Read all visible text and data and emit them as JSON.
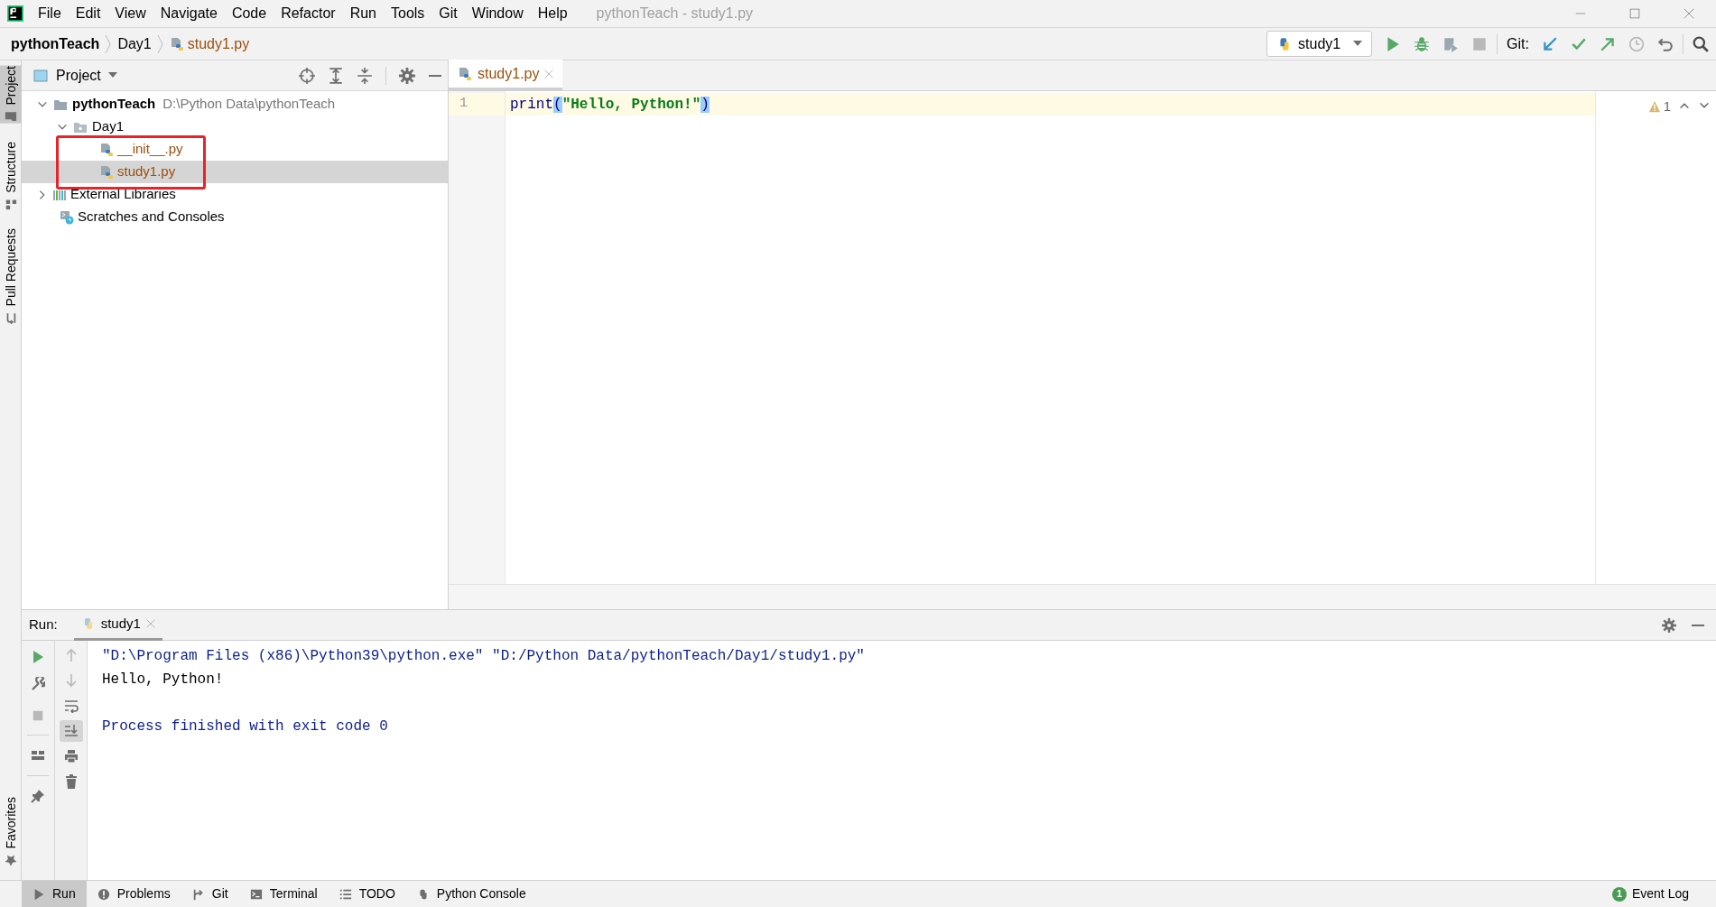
{
  "window": {
    "title": "pythonTeach - study1.py"
  },
  "menu": [
    "File",
    "Edit",
    "View",
    "Navigate",
    "Code",
    "Refactor",
    "Run",
    "Tools",
    "Git",
    "Window",
    "Help"
  ],
  "breadcrumb": [
    {
      "label": "pythonTeach",
      "kind": "project"
    },
    {
      "label": "Day1",
      "kind": "folder"
    },
    {
      "label": "study1.py",
      "kind": "py-file"
    }
  ],
  "toolbar": {
    "run_config": "study1",
    "git_label": "Git:"
  },
  "left_tool_tabs": [
    {
      "label": "Project",
      "selected": true
    },
    {
      "label": "Structure",
      "selected": false
    },
    {
      "label": "Pull Requests",
      "selected": false
    }
  ],
  "left_bottom_tabs": [
    {
      "label": "Favorites",
      "selected": false
    }
  ],
  "project_panel": {
    "title": "Project",
    "tree": [
      {
        "label": "pythonTeach",
        "path": "D:\\Python Data\\pythonTeach",
        "kind": "project",
        "expanded": true,
        "selected": false,
        "children": [
          {
            "label": "Day1",
            "kind": "folder",
            "expanded": true,
            "selected": false,
            "children": [
              {
                "label": "__init__.py",
                "kind": "py-file",
                "selected": false
              },
              {
                "label": "study1.py",
                "kind": "py-file",
                "selected": true
              }
            ]
          }
        ]
      },
      {
        "label": "External Libraries",
        "kind": "libraries",
        "expanded": false,
        "selected": false
      },
      {
        "label": "Scratches and Consoles",
        "kind": "scratches",
        "selected": false
      }
    ]
  },
  "editor": {
    "tabs": [
      {
        "label": "study1.py",
        "selected": true
      }
    ],
    "lines": [
      {
        "number": "1",
        "current": true,
        "tokens": [
          {
            "text": "print",
            "kind": "builtin"
          },
          {
            "text": "(",
            "kind": "brace-match"
          },
          {
            "text": "\"Hello, Python!\"",
            "kind": "string"
          },
          {
            "text": ")",
            "kind": "brace-match"
          }
        ]
      }
    ],
    "warnings": "1"
  },
  "run_panel": {
    "label": "Run:",
    "tabs": [
      {
        "label": "study1",
        "selected": true
      }
    ],
    "scroll_to_end": true,
    "output": [
      {
        "kind": "command",
        "text": "\"D:\\Program Files (x86)\\Python39\\python.exe\" \"D:/Python Data/pythonTeach/Day1/study1.py\""
      },
      {
        "kind": "stdout",
        "text": "Hello, Python!"
      },
      {
        "kind": "blank"
      },
      {
        "kind": "system",
        "text": "Process finished with exit code 0"
      }
    ]
  },
  "bottom_tabs": [
    {
      "label": "Run",
      "kind": "run",
      "selected": true
    },
    {
      "label": "Problems",
      "kind": "problems",
      "selected": false
    },
    {
      "label": "Git",
      "kind": "git",
      "selected": false
    },
    {
      "label": "Terminal",
      "kind": "terminal",
      "selected": false
    },
    {
      "label": "TODO",
      "kind": "todo",
      "selected": false
    },
    {
      "label": "Python Console",
      "kind": "python-console",
      "selected": false
    }
  ],
  "event_log": {
    "label": "Event Log",
    "count": "1"
  }
}
